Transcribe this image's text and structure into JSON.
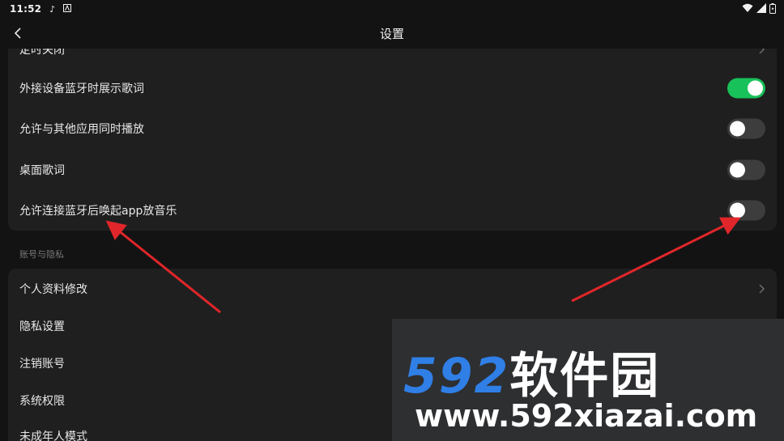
{
  "status_bar": {
    "time": "11:52"
  },
  "header": {
    "title": "设置"
  },
  "settings_card": {
    "partial_top_label": "定时关闭",
    "rows": [
      {
        "label": "外接设备蓝牙时展示歌词",
        "toggle_on": true
      },
      {
        "label": "允许与其他应用同时播放",
        "toggle_on": false
      },
      {
        "label": "桌面歌词",
        "toggle_on": false
      },
      {
        "label": "允许连接蓝牙后唤起app放音乐",
        "toggle_on": false
      }
    ]
  },
  "account_section": {
    "title": "账号与隐私",
    "rows": [
      {
        "label": "个人资料修改"
      },
      {
        "label": "隐私设置"
      },
      {
        "label": "注销账号"
      },
      {
        "label": "系统权限"
      },
      {
        "label": "未成年人模式"
      }
    ]
  },
  "colors": {
    "background": "#131313",
    "card": "#1f1f1f",
    "toggle_on": "#19c15a",
    "toggle_off": "#3d3d3d",
    "annotation_arrow": "#e0262a"
  },
  "watermark": {
    "logo_number": "592",
    "logo_text": "软件园",
    "url": "www.592xiazai.com"
  }
}
